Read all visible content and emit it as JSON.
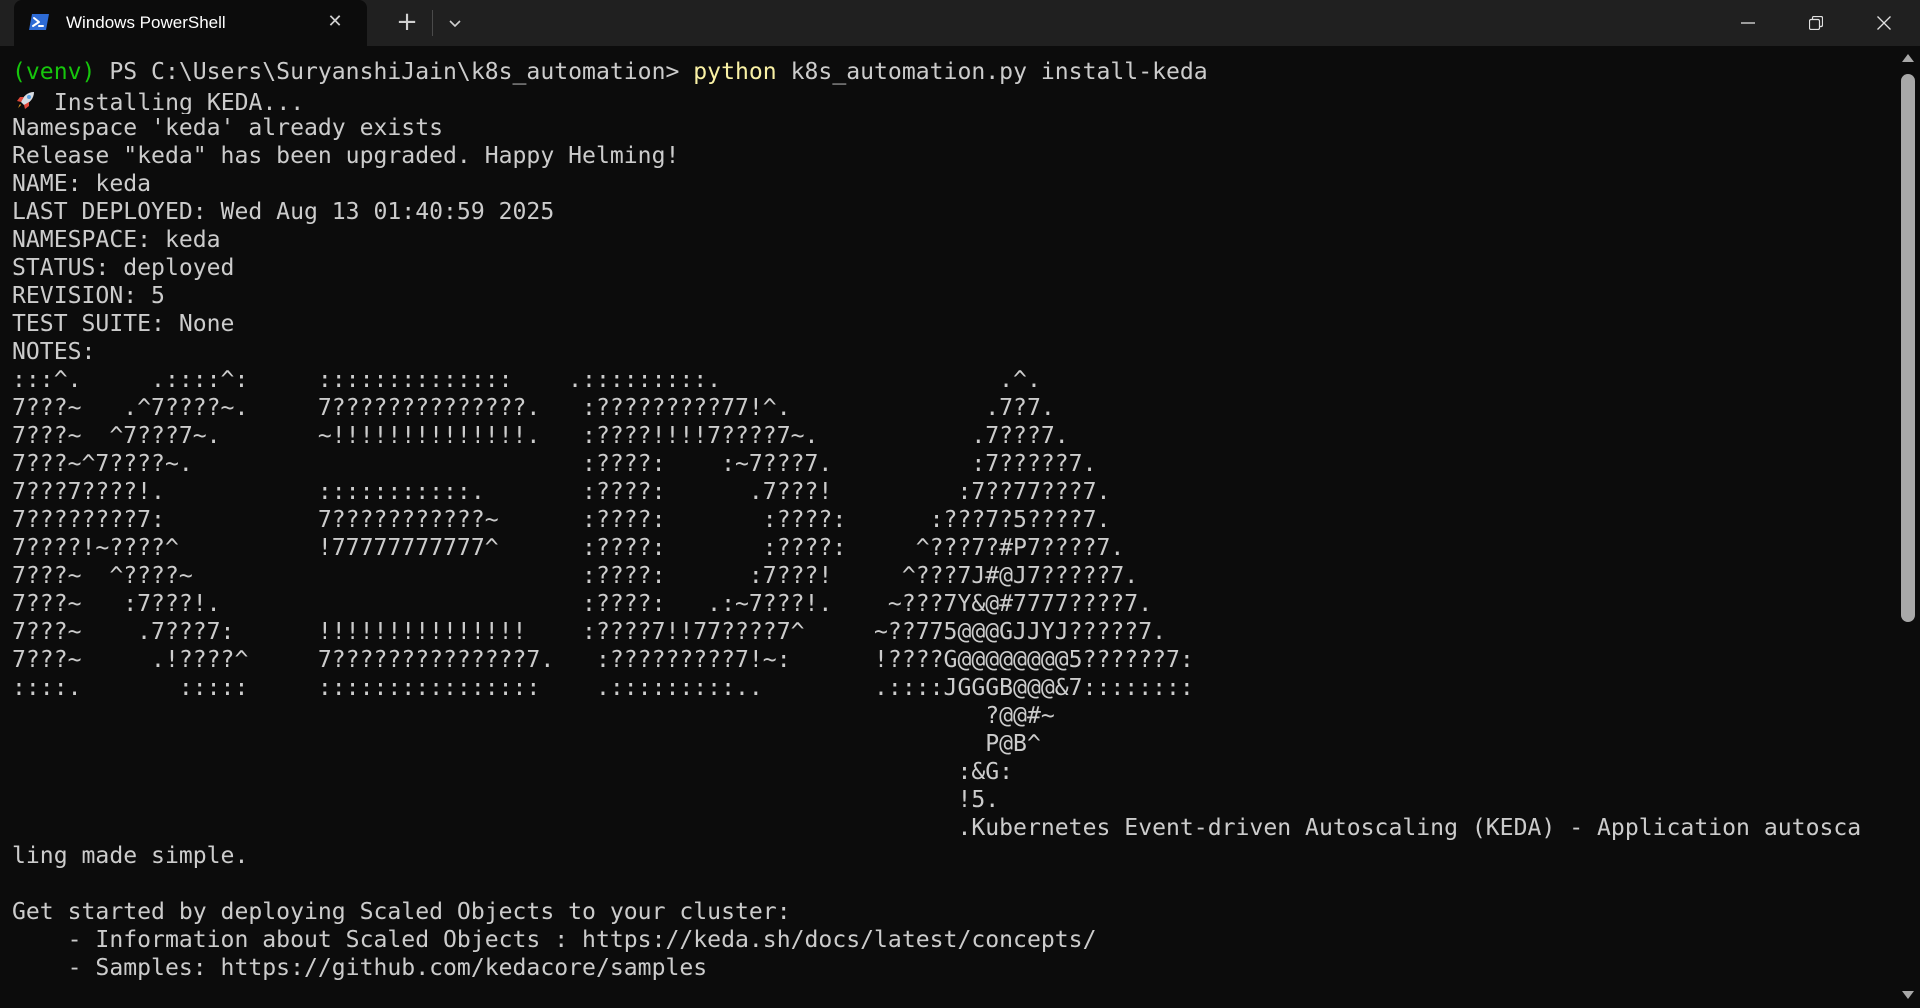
{
  "window": {
    "tab_title": "Windows PowerShell",
    "tab_icon": "powershell-icon",
    "new_tab_glyph": "+",
    "close_glyph": "✕",
    "buttons": [
      "minimize-icon",
      "maximize-icon",
      "close-icon"
    ]
  },
  "prompt": {
    "venv": "(venv)",
    "ps": " PS C:\\Users\\SuryanshiJain\\k8s_automation> ",
    "cmd": "python",
    "args": " k8s_automation.py install-keda"
  },
  "installing": " Installing KEDA...",
  "output": [
    "Namespace 'keda' already exists",
    "Release \"keda\" has been upgraded. Happy Helming!",
    "NAME: keda",
    "LAST DEPLOYED: Wed Aug 13 01:40:59 2025",
    "NAMESPACE: keda",
    "STATUS: deployed",
    "REVISION: 5",
    "TEST SUITE: None",
    "NOTES:"
  ],
  "ascii_art": [
    ":::^.     .::::^:     ::::::::::::::    .:::::::::.                    .^.",
    "7???~   .^7????~.     7??????????????.   :?????????77!^.              .7?7.",
    "7???~  ^7???7~.       ~!!!!!!!!!!!!!!.   :????!!!!7????7~.           .7???7.",
    "7???~^7????~.                            :????:    :~7???7.          :7?????7.",
    "7???7????!.           :::::::::::.       :????:      .7???!         :7??77???7.",
    "7????????7:           7???????????~      :????:       :????:      :???7?5????7.",
    "7????!~????^          !77777777777^      :????:       :????:     ^???7?#P7????7.",
    "7???~  ^????~                            :????:      :7???!     ^???7J#@J7?????7.",
    "7???~   :7???!.                          :????:   .:~7???!.    ~???7Y&@#7777????7.",
    "7???~    .7???7:      !!!!!!!!!!!!!!!    :????7!!77????7^     ~??775@@@GJJYJ?????7.",
    "7???~     .!????^     7??????????????7.   :?????????7!~:      !????G@@@@@@@@5??????7:",
    "::::.       :::::     ::::::::::::::::    .:::::::::..        .::::JGGGB@@@&7::::::::",
    "                                                                      ?@@#~",
    "                                                                      P@B^",
    "                                                                    :&G:",
    "                                                                    !5.",
    "                                                                    .Kubernetes Event-driven Autoscaling (KEDA) - Application autosca",
    "ling made simple.",
    "",
    "Get started by deploying Scaled Objects to your cluster:",
    "    - Information about Scaled Objects : https://keda.sh/docs/latest/concepts/",
    "    - Samples: https://github.com/kedacore/samples"
  ],
  "colors": {
    "background": "#0c0c0c",
    "text": "#cccccc",
    "venv": "#16c60c",
    "command": "#f9f1a5",
    "titlebar": "#202020"
  }
}
